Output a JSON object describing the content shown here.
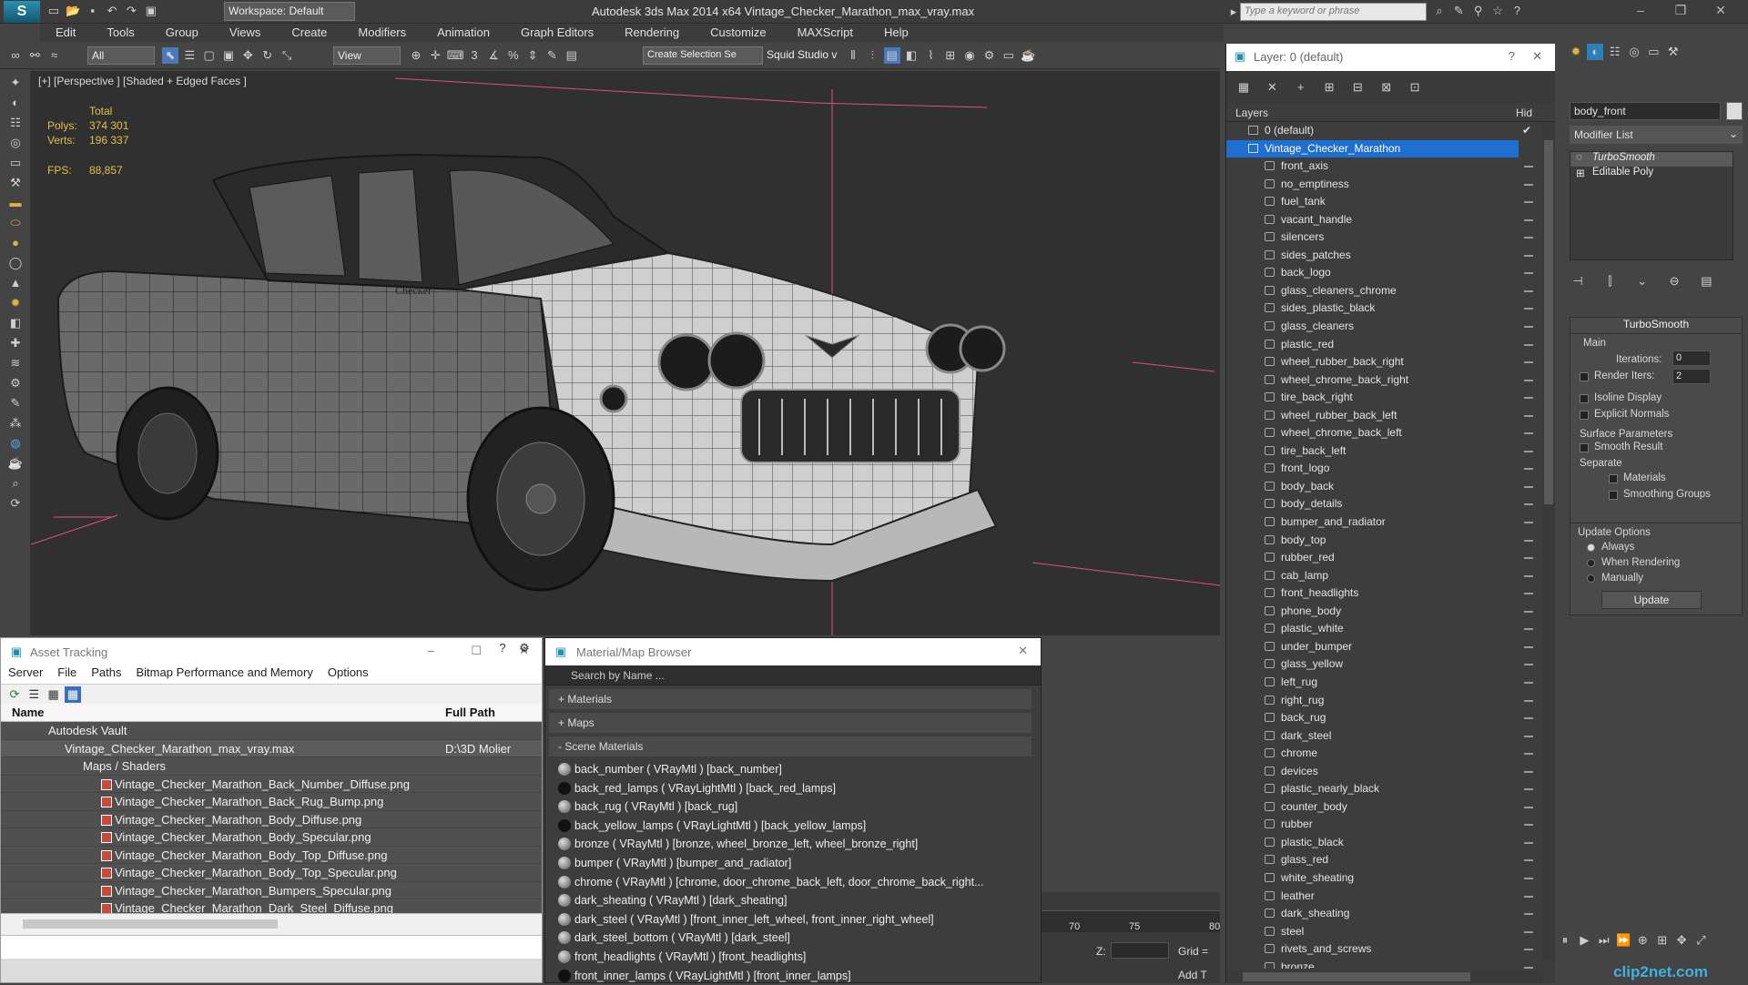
{
  "title_bar": {
    "app_title": "Autodesk 3ds Max  2014 x64      Vintage_Checker_Marathon_max_vray.max",
    "workspace": "Workspace: Default",
    "search_placeholder": "Type a keyword or phrase"
  },
  "menu": [
    "Edit",
    "Tools",
    "Group",
    "Views",
    "Create",
    "Modifiers",
    "Animation",
    "Graph Editors",
    "Rendering",
    "Customize",
    "MAXScript",
    "Help"
  ],
  "toolbar": {
    "filter": "All",
    "ref_coord": "View",
    "selection_set": "Create Selection Se",
    "squid": "Squid Studio v"
  },
  "viewport": {
    "label": "[+] [Perspective ] [Shaded + Edged Faces ]",
    "total_label": "Total",
    "polys_label": "Polys:",
    "polys_value": "374 301",
    "verts_label": "Verts:",
    "verts_value": "196 337",
    "fps_label": "FPS:",
    "fps_value": "88,857",
    "emblem": "Checker"
  },
  "asset_tracking": {
    "title": "Asset Tracking",
    "menu": [
      "Server",
      "File",
      "Paths",
      "Bitmap Performance and Memory",
      "Options"
    ],
    "columns": [
      "Name",
      "Full Path"
    ],
    "vault": "Autodesk Vault",
    "scene_file": "Vintage_Checker_Marathon_max_vray.max",
    "scene_path": "D:\\3D Molier",
    "maps_group": "Maps / Shaders",
    "files": [
      "Vintage_Checker_Marathon_Back_Number_Diffuse.png",
      "Vintage_Checker_Marathon_Back_Rug_Bump.png",
      "Vintage_Checker_Marathon_Body_Diffuse.png",
      "Vintage_Checker_Marathon_Body_Specular.png",
      "Vintage_Checker_Marathon_Body_Top_Diffuse.png",
      "Vintage_Checker_Marathon_Body_Top_Specular.png",
      "Vintage_Checker_Marathon_Bumpers_Specular.png",
      "Vintage_Checker_Marathon_Dark_Steel_Diffuse.png"
    ]
  },
  "material_browser": {
    "title": "Material/Map Browser",
    "search_placeholder": "Search by Name ...",
    "cat_materials": "+ Materials",
    "cat_maps": "+ Maps",
    "cat_scene": "- Scene Materials",
    "materials": [
      "back_number  ( VRayMtl )  [back_number]",
      "back_red_lamps  ( VRayLightMtl )  [back_red_lamps]",
      "back_rug  ( VRayMtl )  [back_rug]",
      "back_yellow_lamps  ( VRayLightMtl )  [back_yellow_lamps]",
      "bronze  ( VRayMtl )  [bronze, wheel_bronze_left, wheel_bronze_right]",
      "bumper  ( VRayMtl )  [bumper_and_radiator]",
      "chrome  ( VRayMtl )  [chrome, door_chrome_back_left, door_chrome_back_right...",
      "dark_sheating  ( VRayMtl )  [dark_sheating]",
      "dark_steel  ( VRayMtl )  [front_inner_left_wheel, front_inner_right_wheel]",
      "dark_steel_bottom  ( VRayMtl )  [dark_steel]",
      "front_headlights  ( VRayMtl )  [front_headlights]",
      "front_inner_lamps  ( VRayLightMtl )  [front_inner_lamps]"
    ]
  },
  "timeline": {
    "ticks": [
      "70",
      "75",
      "80"
    ],
    "z_label": "Z:",
    "grid_label": "Grid =",
    "add_label": "Add T"
  },
  "layer_explorer": {
    "title": "Layer: 0 (default)",
    "col_layers": "Layers",
    "col_hide": "Hid",
    "default_layer": "0 (default)",
    "selected_layer": "Vintage_Checker_Marathon",
    "objects": [
      "front_axis",
      "no_emptiness",
      "fuel_tank",
      "vacant_handle",
      "silencers",
      "sides_patches",
      "back_logo",
      "glass_cleaners_chrome",
      "sides_plastic_black",
      "glass_cleaners",
      "plastic_red",
      "wheel_rubber_back_right",
      "wheel_chrome_back_right",
      "tire_back_right",
      "wheel_rubber_back_left",
      "wheel_chrome_back_left",
      "tire_back_left",
      "front_logo",
      "body_back",
      "body_details",
      "bumper_and_radiator",
      "body_top",
      "rubber_red",
      "cab_lamp",
      "front_headlights",
      "phone_body",
      "plastic_white",
      "under_bumper",
      "glass_yellow",
      "left_rug",
      "right_rug",
      "back_rug",
      "dark_steel",
      "chrome",
      "devices",
      "plastic_nearly_black",
      "counter_body",
      "rubber",
      "plastic_black",
      "glass_red",
      "white_sheating",
      "leather",
      "dark_sheating",
      "steel",
      "rivets_and_screws",
      "bronze"
    ]
  },
  "command_panel": {
    "object_name": "body_front",
    "modifier_list": "Modifier List",
    "stack": [
      "TurboSmooth",
      "Editable Poly"
    ],
    "rollout_title": "TurboSmooth",
    "main_label": "Main",
    "iterations_label": "Iterations:",
    "iterations_value": "0",
    "render_iters_label": "Render Iters:",
    "render_iters_value": "2",
    "isoline": "Isoline Display",
    "explicit_normals": "Explicit Normals",
    "surface_params": "Surface Parameters",
    "smooth_result": "Smooth Result",
    "separate": "Separate",
    "materials": "Materials",
    "smoothing_groups": "Smoothing Groups",
    "update_options": "Update Options",
    "always": "Always",
    "when_rendering": "When Rendering",
    "manually": "Manually",
    "update_btn": "Update",
    "watermark": "clip2net.com"
  },
  "colors": {
    "selection_blue": "#1f6fd1",
    "stat_yellow": "#e0c04a",
    "viewport_bg": "#303030"
  }
}
